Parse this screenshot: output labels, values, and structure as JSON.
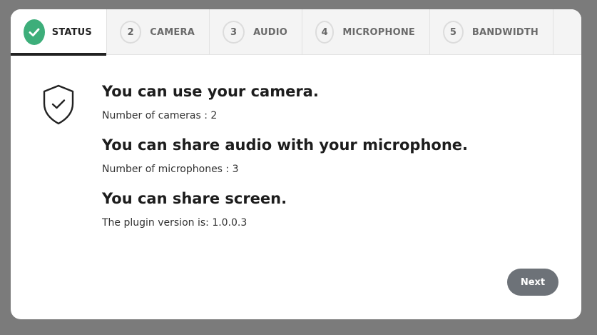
{
  "tabs": [
    {
      "label": "STATUS",
      "state": "complete",
      "icon": "check-icon"
    },
    {
      "number": "2",
      "label": "CAMERA"
    },
    {
      "number": "3",
      "label": "AUDIO"
    },
    {
      "number": "4",
      "label": "MICROPHONE"
    },
    {
      "number": "5",
      "label": "BANDWIDTH"
    }
  ],
  "status": {
    "icon": "shield-check-icon",
    "items": [
      {
        "heading": "You can use your camera.",
        "detail": "Number of cameras : 2"
      },
      {
        "heading": "You can share audio with your microphone.",
        "detail": "Number of microphones : 3"
      },
      {
        "heading": "You can share screen.",
        "detail": "The plugin version is: 1.0.0.3"
      }
    ]
  },
  "footer": {
    "next_label": "Next"
  },
  "colors": {
    "success": "#3dae7a",
    "button": "#6d7278",
    "overlay": "#7b7b7b"
  }
}
